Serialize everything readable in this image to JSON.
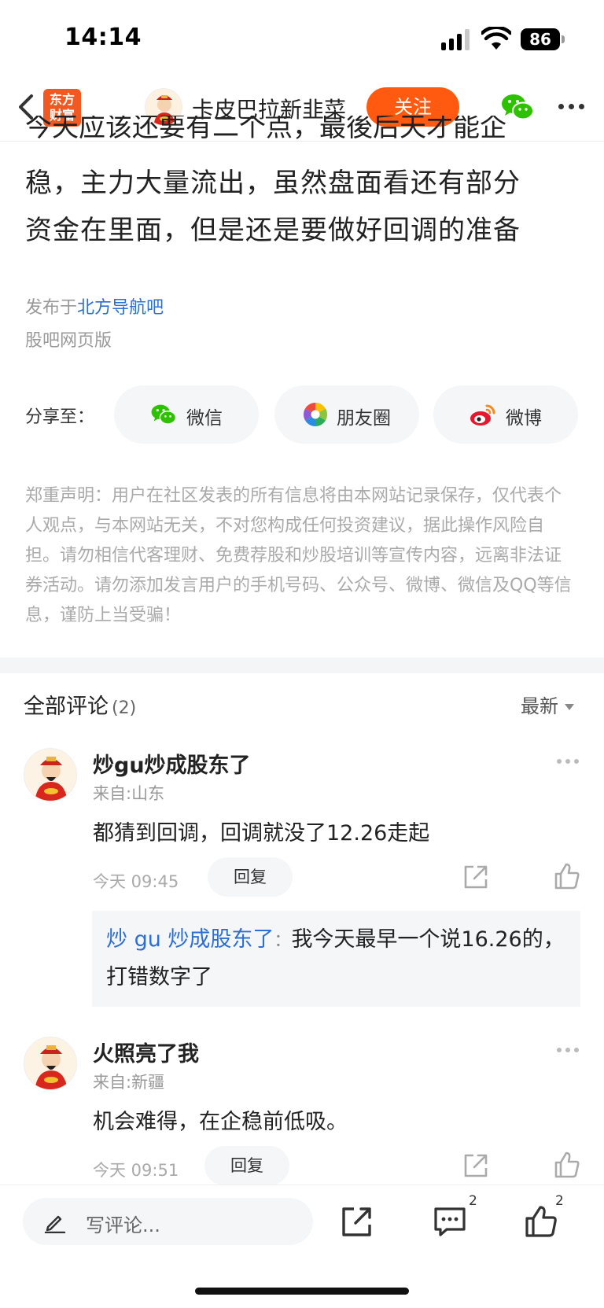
{
  "status_bar": {
    "time": "14:14",
    "battery": "86"
  },
  "nav": {
    "logo_line1": "东方",
    "logo_line2": "财富",
    "author_name": "卡皮巴拉新韭菜",
    "follow_label": "关注"
  },
  "article": {
    "clipped_line": "今天应该还要有二个点，最後后天才能企",
    "lines": [
      "稳，主力大量流出，虽然盘面看还有部分",
      "资金在里面，但是还是要做好回调的准备"
    ],
    "published_prefix": "发布于",
    "published_forum": "北方导航吧",
    "source": "股吧网页版"
  },
  "share": {
    "label": "分享至：",
    "buttons": [
      {
        "label": "微信",
        "icon": "wechat-icon"
      },
      {
        "label": "朋友圈",
        "icon": "moments-icon"
      },
      {
        "label": "微博",
        "icon": "weibo-icon"
      }
    ]
  },
  "disclaimer": "郑重声明：用户在社区发表的所有信息将由本网站记录保存，仅代表个人观点，与本网站无关，不对您构成任何投资建议，据此操作风险自担。请勿相信代客理财、免费荐股和炒股培训等宣传内容，远离非法证券活动。请勿添加发言用户的手机号码、公众号、微博、微信及QQ等信息，谨防上当受骗！",
  "comments_header": {
    "title": "全部评论",
    "count": "(2)",
    "sort": "最新"
  },
  "comments": [
    {
      "name": "炒gu炒成股东了",
      "location": "来自:山东",
      "text": "都猜到回调，回调就没了12.26走起",
      "time": "今天 09:45",
      "reply_label": "回复",
      "reply": {
        "who": "炒 gu 炒成股东了",
        "sep": "：",
        "text": "我今天最早一个说16.26的，打错数字了"
      }
    },
    {
      "name": "火照亮了我",
      "location": "来自:新疆",
      "text": "机会难得，在企稳前低吸。",
      "time": "今天 09:51",
      "reply_label": "回复"
    }
  ],
  "bottom_bar": {
    "placeholder": "写评论...",
    "comment_count": "2",
    "like_count": "2"
  },
  "colors": {
    "accent": "#ff5a10",
    "link": "#2b6fd6",
    "logo": "#f05a22"
  }
}
